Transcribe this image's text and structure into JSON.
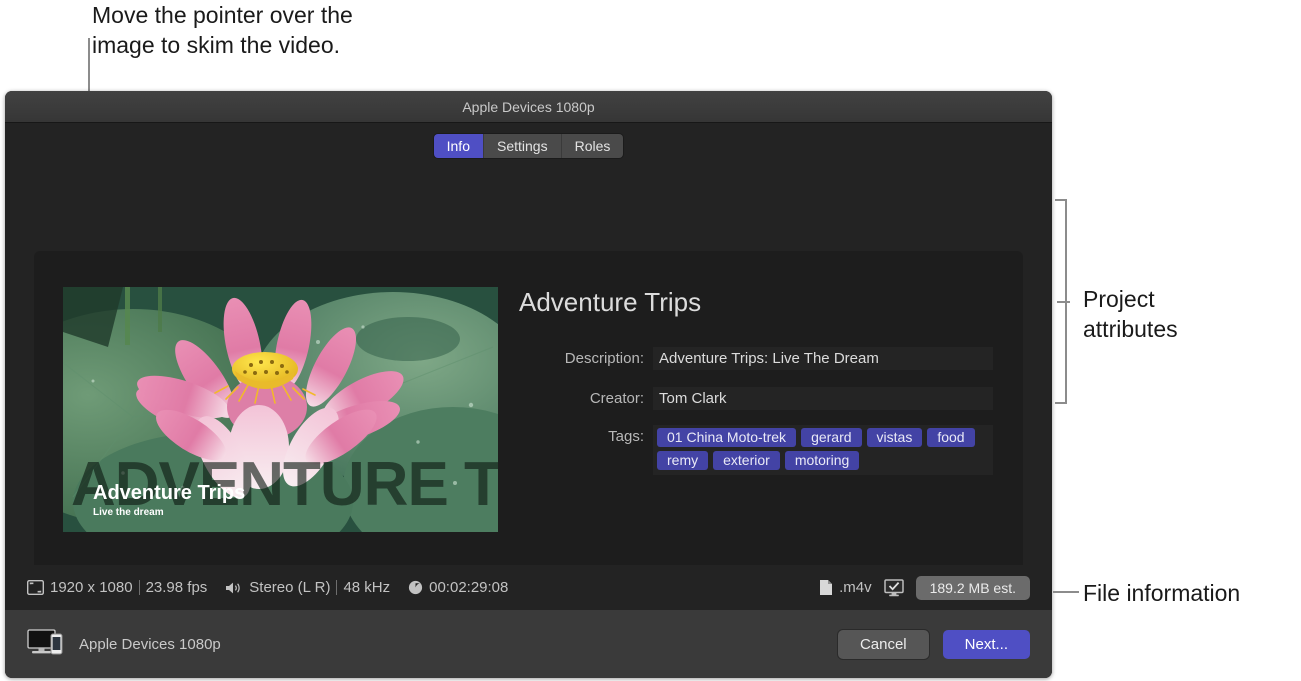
{
  "annotations": {
    "top_callout": "Move the pointer over the\nimage to skim the video.",
    "right_callout_1": "Project\nattributes",
    "right_callout_2": "File information"
  },
  "window": {
    "title": "Apple Devices 1080p"
  },
  "tabs": [
    {
      "label": "Info",
      "active": true
    },
    {
      "label": "Settings",
      "active": false
    },
    {
      "label": "Roles",
      "active": false
    }
  ],
  "thumbnail": {
    "overlay_big_text": "ADVENTURE TRIPS",
    "overlay_title": "Adventure Trips",
    "overlay_subtitle": "Live the dream"
  },
  "project": {
    "title": "Adventure Trips",
    "description_label": "Description:",
    "description_value": "Adventure Trips: Live The Dream",
    "creator_label": "Creator:",
    "creator_value": "Tom Clark",
    "tags_label": "Tags:",
    "tags": [
      "01 China Moto-trek",
      "gerard",
      "vistas",
      "food",
      "remy",
      "exterior",
      "motoring"
    ]
  },
  "status": {
    "resolution": "1920 x 1080",
    "framerate": "23.98 fps",
    "audio_channels": "Stereo (L R)",
    "sample_rate": "48 kHz",
    "duration": "00:02:29:08",
    "file_extension": ".m4v",
    "size_estimate": "189.2 MB est."
  },
  "footer": {
    "device_label": "Apple Devices 1080p",
    "cancel_label": "Cancel",
    "next_label": "Next..."
  },
  "colors": {
    "accent": "#4f4fc4",
    "tag": "#4343a5",
    "window_bg": "#232323",
    "panel_bg": "#1d1d1d"
  }
}
